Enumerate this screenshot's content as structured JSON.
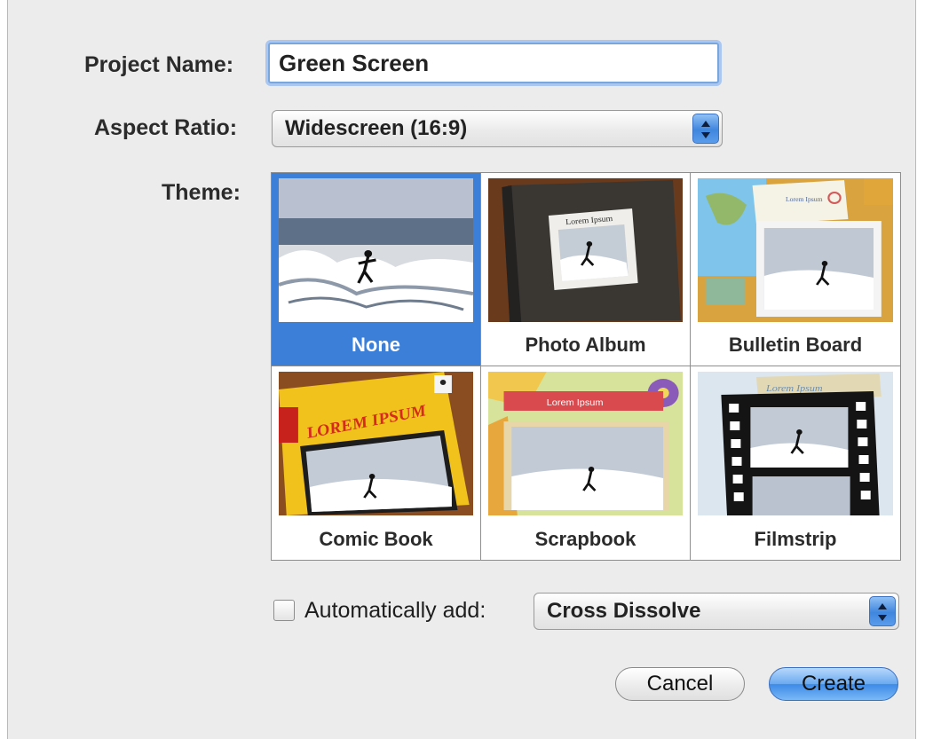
{
  "form": {
    "project_name_label": "Project Name:",
    "project_name_value": "Green Screen",
    "aspect_ratio_label": "Aspect Ratio:",
    "aspect_ratio_value": "Widescreen (16:9)",
    "theme_label": "Theme:"
  },
  "themes": [
    {
      "label": "None",
      "selected": true
    },
    {
      "label": "Photo Album",
      "selected": false
    },
    {
      "label": "Bulletin Board",
      "selected": false
    },
    {
      "label": "Comic Book",
      "selected": false
    },
    {
      "label": "Scrapbook",
      "selected": false
    },
    {
      "label": "Filmstrip",
      "selected": false
    }
  ],
  "thumb_text": {
    "album_title": "Lorem Ipsum",
    "bulletin_title": "Lorem Ipsum",
    "comic_title": "LOREM IPSUM",
    "scrapbook_title": "Lorem Ipsum",
    "filmstrip_title": "Lorem Ipsum"
  },
  "auto_add": {
    "label": "Automatically add:",
    "checked": false,
    "value": "Cross Dissolve"
  },
  "buttons": {
    "cancel": "Cancel",
    "create": "Create"
  },
  "colors": {
    "selection": "#3c7fd9",
    "default_button": "#3d8ae7",
    "focus_ring": "#a9c7f0"
  }
}
